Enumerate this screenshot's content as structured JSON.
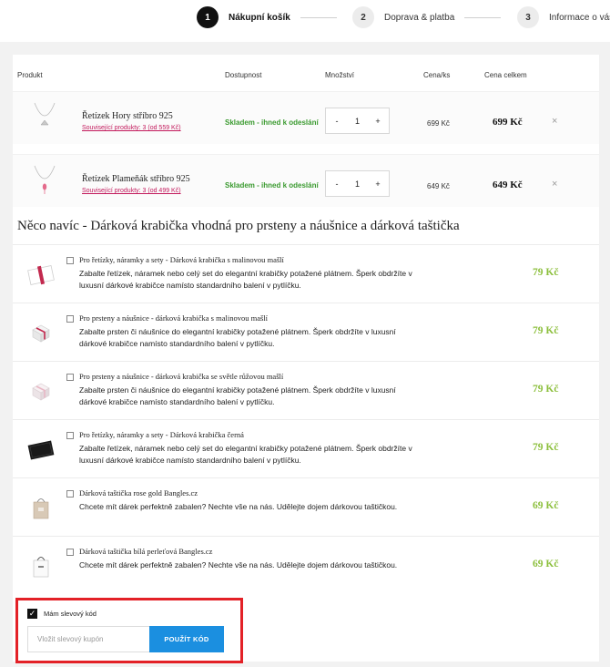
{
  "steps": [
    {
      "num": "1",
      "label": "Nákupní košík"
    },
    {
      "num": "2",
      "label": "Doprava & platba"
    },
    {
      "num": "3",
      "label": "Informace o vás"
    }
  ],
  "cart": {
    "headers": {
      "product": "Produkt",
      "availability": "Dostupnost",
      "quantity": "Množství",
      "unit_price": "Cena/ks",
      "total_price": "Cena celkem"
    },
    "items": [
      {
        "name": "Řetízek Hory stříbro 925",
        "related": "Související produkty: 3 (od 559 Kč)",
        "stock": "Skladem - ihned k odeslání",
        "qty": "1",
        "unit_price": "699 Kč",
        "total": "699 Kč",
        "remove": "×",
        "minus": "-",
        "plus": "+",
        "thumb_icon": "necklace-mountain"
      },
      {
        "name": "Řetízek Plameňák stříbro 925",
        "related": "Související produkty: 3 (od 499 Kč)",
        "stock": "Skladem - ihned k odeslání",
        "qty": "1",
        "unit_price": "649 Kč",
        "total": "649 Kč",
        "remove": "×",
        "minus": "-",
        "plus": "+",
        "thumb_icon": "necklace-flamingo"
      }
    ]
  },
  "extras": {
    "title": "Něco navíc - Dárková krabička vhodná pro prsteny a náušnice a dárková taštička",
    "items": [
      {
        "name": "Pro řetízky, náramky a sety - Dárková krabička s malinovou mašlí",
        "desc": "Zabalte řetízek, náramek nebo celý set do elegantní krabičky potažené plátnem. Šperk obdržíte v luxusní dárkové krabičce namísto standardního balení v pytlíčku.",
        "price": "79 Kč",
        "thumb_icon": "gift-box-raspberry"
      },
      {
        "name": "Pro prsteny a náušnice - dárková krabička s malinovou mašlí",
        "desc": "Zabalte prsten či náušnice do elegantní krabičky potažené plátnem. Šperk obdržíte v luxusní dárkové krabičce namísto standardního balení v pytlíčku.",
        "price": "79 Kč",
        "thumb_icon": "ring-box-raspberry"
      },
      {
        "name": "Pro prsteny a náušnice - dárková krabička se světle růžovou mašlí",
        "desc": "Zabalte prsten či náušnice do elegantní krabičky potažené plátnem. Šperk obdržíte v luxusní dárkové krabičce namísto standardního balení v pytlíčku.",
        "price": "79 Kč",
        "thumb_icon": "ring-box-pink"
      },
      {
        "name": "Pro řetízky, náramky a sety - Dárková krabička černá",
        "desc": "Zabalte řetízek, náramek nebo celý set do elegantní krabičky potažené plátnem. Šperk obdržíte v luxusní dárkové krabičce namísto standardního balení v pytlíčku.",
        "price": "79 Kč",
        "thumb_icon": "gift-box-black"
      },
      {
        "name": "Dárková taštička rose gold Bangles.cz",
        "desc": "Chcete mít dárek perfektně zabalen? Nechte vše na nás. Udělejte dojem dárkovou taštičkou.",
        "price": "69 Kč",
        "thumb_icon": "gift-bag-rose-gold"
      },
      {
        "name": "Dárková taštička bílá perleťová Bangles.cz",
        "desc": "Chcete mít dárek perfektně zabalen? Nechte vše na nás. Udělejte dojem dárkovou taštičkou.",
        "price": "69 Kč",
        "thumb_icon": "gift-bag-white"
      }
    ]
  },
  "discount": {
    "checkbox_label": "Mám slevový kód",
    "checked": true,
    "input_placeholder": "Vložit slevový kupón",
    "button_label": "POUŽÍT KÓD"
  },
  "colors": {
    "accent": "#1b8fe0",
    "stock_green": "#3a9a2f",
    "extra_price": "#8cbf3c",
    "highlight": "#e32127",
    "link": "#c2185b"
  }
}
